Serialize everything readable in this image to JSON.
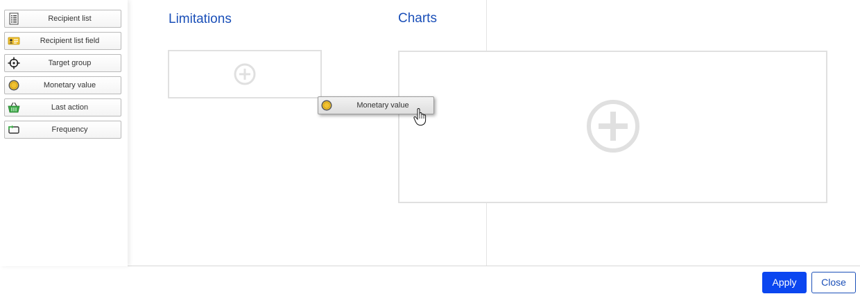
{
  "palette": {
    "items": [
      {
        "label": "Recipient list",
        "icon": "list-icon"
      },
      {
        "label": "Recipient list field",
        "icon": "id-card-icon"
      },
      {
        "label": "Target group",
        "icon": "crosshair-icon"
      },
      {
        "label": "Monetary value",
        "icon": "coin-icon"
      },
      {
        "label": "Last action",
        "icon": "basket-icon"
      },
      {
        "label": "Frequency",
        "icon": "repeat-icon"
      }
    ]
  },
  "limitations": {
    "title": "Limitations"
  },
  "charts": {
    "title": "Charts"
  },
  "drag": {
    "label": "Monetary value"
  },
  "footer": {
    "apply_label": "Apply",
    "close_label": "Close"
  },
  "colors": {
    "accent": "#1a4fb8",
    "apply_bg": "#0b46f0",
    "coin": "#f1c232",
    "basket": "#3aa845"
  }
}
